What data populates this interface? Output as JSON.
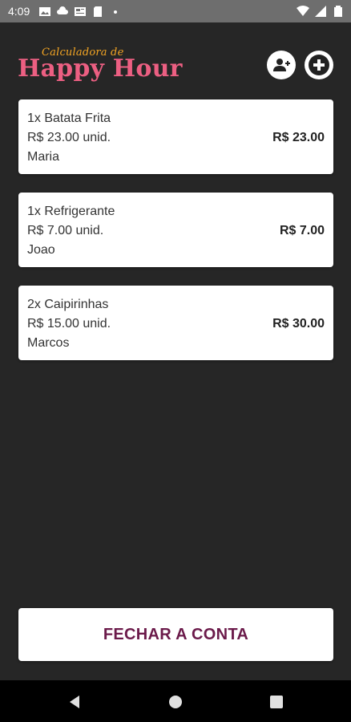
{
  "status_bar": {
    "time": "4:09",
    "icons_left": [
      "gallery-icon",
      "cloud-icon",
      "news-icon",
      "sd-card-icon",
      "dot-icon"
    ],
    "icons_right": [
      "wifi-icon",
      "signal-icon",
      "battery-icon"
    ]
  },
  "header": {
    "logo_small": "Calculadora de",
    "logo_big": "Happy Hour",
    "colors": {
      "logo_small": "#f5a623",
      "logo_big": "#ec5f82"
    },
    "actions": [
      "add-person-icon",
      "add-circle-icon"
    ]
  },
  "items": [
    {
      "name": "1x Batata Frita",
      "unit": "R$ 23.00 unid.",
      "person": "Maria",
      "total": "R$ 23.00"
    },
    {
      "name": "1x Refrigerante",
      "unit": "R$ 7.00 unid.",
      "person": "Joao",
      "total": "R$ 7.00"
    },
    {
      "name": "2x Caipirinhas",
      "unit": "R$ 15.00 unid.",
      "person": "Marcos",
      "total": "R$ 30.00"
    }
  ],
  "footer": {
    "close_label": "FECHAR A CONTA",
    "close_color": "#6b1a4a"
  },
  "nav": [
    "back-icon",
    "home-icon",
    "recents-icon"
  ]
}
